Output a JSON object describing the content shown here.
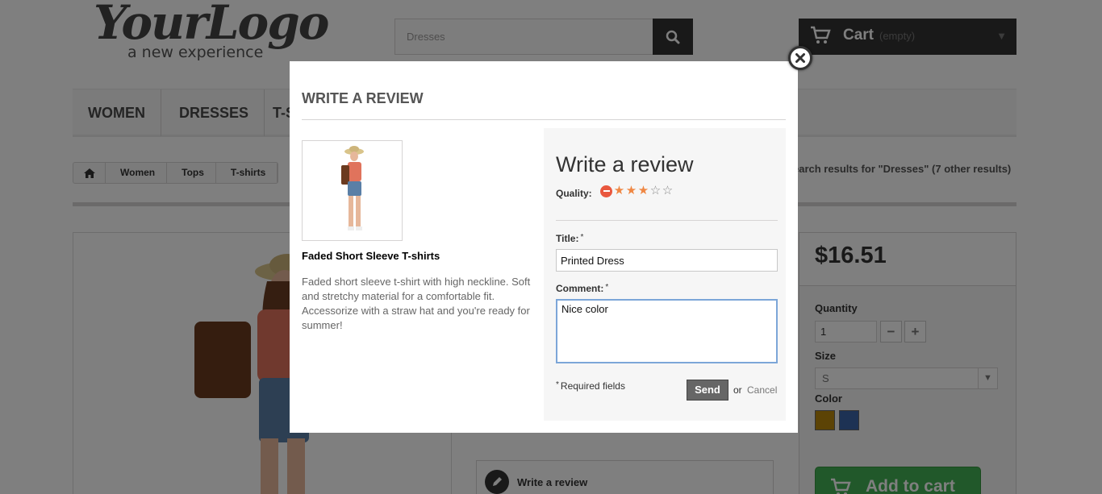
{
  "header": {
    "logo_main": "YourLogo",
    "logo_sub": "a new experience",
    "search_placeholder": "Dresses",
    "cart_label": "Cart",
    "cart_status": "(empty)"
  },
  "menu": {
    "items": [
      "WOMEN",
      "DRESSES",
      "T-S"
    ]
  },
  "breadcrumb": {
    "items": [
      "Women",
      "Tops",
      "T-shirts"
    ],
    "search_results": "earch results for \"Dresses\" (7 other results)"
  },
  "product_page": {
    "price": "$16.51",
    "quantity_label": "Quantity",
    "quantity_value": "1",
    "qty_minus": "−",
    "qty_plus": "+",
    "size_label": "Size",
    "size_value": "S",
    "color_label": "Color",
    "colors": [
      "#b8860b",
      "#3a64a8"
    ],
    "add_to_cart": "Add to cart",
    "write_review": "Write a review"
  },
  "modal": {
    "heading": "WRITE A REVIEW",
    "product_name": "Faded Short Sleeve T-shirts",
    "product_description": "Faded short sleeve t-shirt with high neckline. Soft and stretchy material for a comfortable fit. Accessorize with a straw hat and you're ready for summer!",
    "form_title": "Write a review",
    "quality_label": "Quality:",
    "rating": 3,
    "rating_max": 5,
    "title_label": "Title:",
    "title_value": "Printed Dress",
    "comment_label": "Comment:",
    "comment_value": "Nice color",
    "required_mark": "*",
    "required_note": "Required fields",
    "send_label": "Send",
    "or_text": "or",
    "cancel_label": "Cancel"
  },
  "colors": {
    "star_active": "#ef8743",
    "cancel_rating": "#e9573e",
    "add_to_cart_green": "#43b155",
    "dark": "#333333"
  }
}
